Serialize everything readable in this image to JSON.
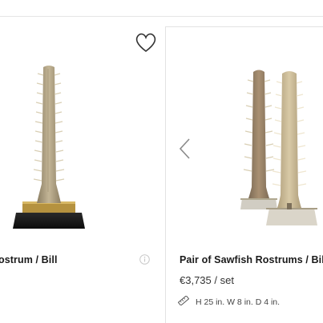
{
  "products": [
    {
      "title": "ostrum / Bill",
      "info_icon": "info-icon",
      "favorite_icon": "heart-outline-icon"
    },
    {
      "title": "Pair of Sawfish Rostrums / Bil",
      "price": "€3,735 / set",
      "dimensions": "H 25 in. W 8 in. D 4 in.",
      "dimensions_icon": "ruler-icon",
      "carousel_icon": "chevron-left-icon"
    }
  ]
}
